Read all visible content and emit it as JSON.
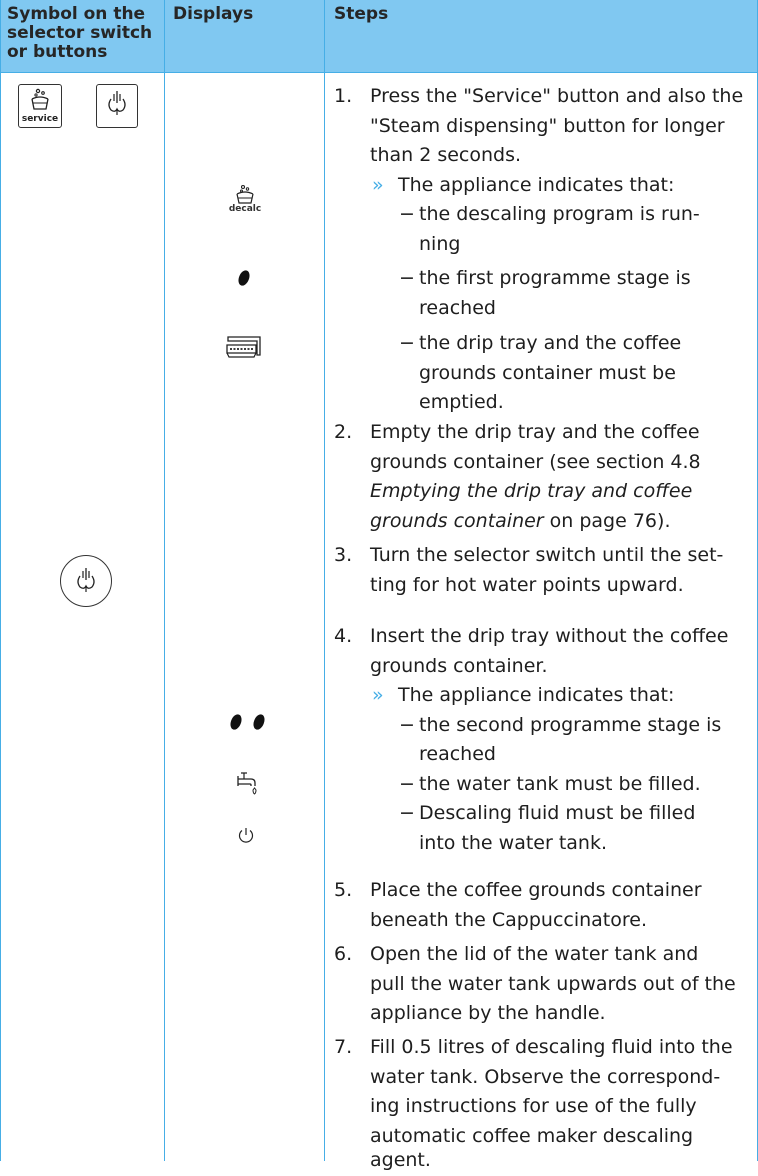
{
  "table": {
    "headers": [
      "Symbol on the selector switch or buttons",
      "Displays",
      "Steps"
    ],
    "header_lines": {
      "col1": [
        "Symbol on the",
        "selector switch",
        "or buttons"
      ],
      "col2": "Displays",
      "col3": "Steps"
    }
  },
  "symbols": {
    "service_button_label": "service",
    "decalc_label": "decalc"
  },
  "icons": {
    "service": "cup-with-bubbles-icon",
    "steam": "steam-tap-icon",
    "decalc": "cup-with-bubbles-icon",
    "one_dot": "single-bean-indicator-icon",
    "drip_tray": "drip-tray-icon",
    "selector_switch": "selector-switch-icon",
    "two_dots": "double-bean-indicator-icon",
    "water_tap": "water-tap-icon",
    "power": "power-icon"
  },
  "steps": {
    "s1": {
      "num": "1.",
      "lines": [
        "Press the \"Service\" button and also the",
        "\"Steam dispensing\" button for longer",
        "than 2 seconds."
      ],
      "result": "The appliance indicates that:",
      "items": [
        [
          "the descaling program is run-",
          "ning"
        ],
        [
          "the first programme stage is",
          "reached"
        ],
        [
          "the drip tray and the coffee",
          "grounds container must be",
          "emptied."
        ]
      ]
    },
    "s2": {
      "num": "2.",
      "line1": "Empty the drip tray and the coffee",
      "line2": "grounds container (see section  4.8",
      "line3_italic": "Emptying the drip tray and coffee",
      "line4_italic": "grounds container",
      "line4_rest": " on page 76)."
    },
    "s3": {
      "num": "3.",
      "lines": [
        "Turn the selector switch until the set-",
        "ting for hot water points upward."
      ]
    },
    "s4": {
      "num": "4.",
      "lines": [
        "Insert the drip tray without the coffee",
        "grounds container."
      ],
      "result": "The appliance indicates that:",
      "items": [
        [
          "the second programme stage is",
          "reached"
        ],
        [
          "the water tank must be filled."
        ],
        [
          "Descaling fluid must be filled",
          "into the water tank."
        ]
      ]
    },
    "s5": {
      "num": "5.",
      "lines": [
        "Place the coffee grounds container",
        "beneath the Cappuccinatore."
      ]
    },
    "s6": {
      "num": "6.",
      "lines": [
        "Open the lid of the water tank and",
        "pull the water tank upwards out of the",
        "appliance by the handle."
      ]
    },
    "s7": {
      "num": "7.",
      "lines": [
        "Fill 0.5 litres of descaling fluid into the",
        "water tank. Observe the correspond-",
        "ing instructions for use of the fully",
        "automatic coffee maker descaling",
        "agent."
      ]
    }
  }
}
